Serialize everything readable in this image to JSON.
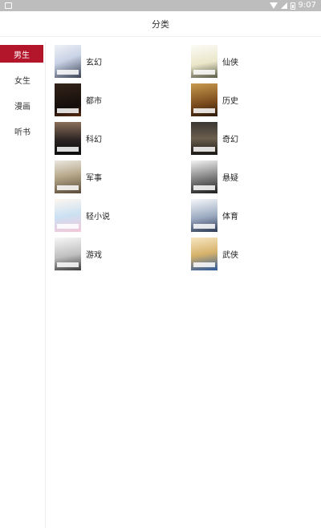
{
  "status_bar": {
    "time": "9:07",
    "icons": [
      "notification-icon",
      "wifi-icon",
      "signal-icon",
      "battery-icon"
    ]
  },
  "header": {
    "title": "分类"
  },
  "sidebar": {
    "items": [
      {
        "label": "男生",
        "active": true
      },
      {
        "label": "女生",
        "active": false
      },
      {
        "label": "漫画",
        "active": false
      },
      {
        "label": "听书",
        "active": false
      }
    ],
    "active_color": "#b3152b"
  },
  "categories": [
    {
      "label": "玄幻"
    },
    {
      "label": "仙侠"
    },
    {
      "label": "都市"
    },
    {
      "label": "历史"
    },
    {
      "label": "科幻"
    },
    {
      "label": "奇幻"
    },
    {
      "label": "军事"
    },
    {
      "label": "悬疑"
    },
    {
      "label": "轻小说"
    },
    {
      "label": "体育"
    },
    {
      "label": "游戏"
    },
    {
      "label": "武侠"
    }
  ]
}
